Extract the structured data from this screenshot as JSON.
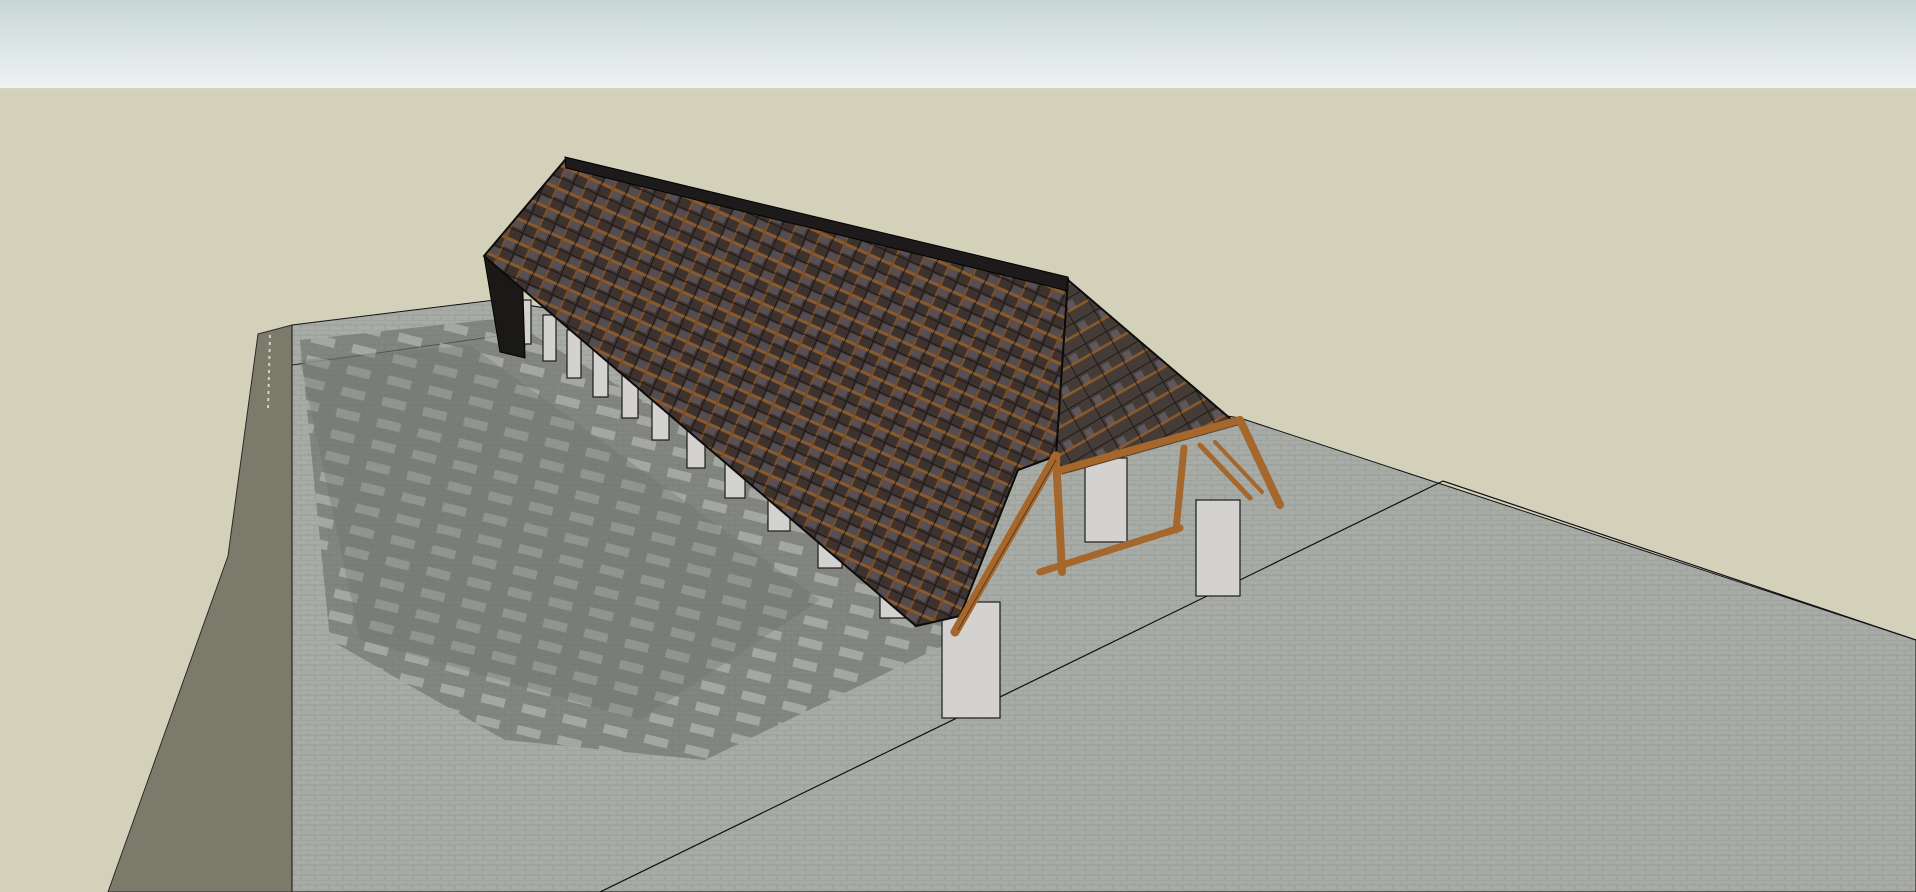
{
  "window": {
    "title": ""
  },
  "viewport": {
    "sky_top": "#c8d6d6",
    "sky_bottom": "#eef3f3",
    "ground": "#d4d1bb",
    "plaza": "#a7aaa4",
    "plaza_left_edge": "#7e7c6c",
    "roof": "#3b302c",
    "timber": "#a86a2d",
    "pillar": "#d4d3d1"
  }
}
